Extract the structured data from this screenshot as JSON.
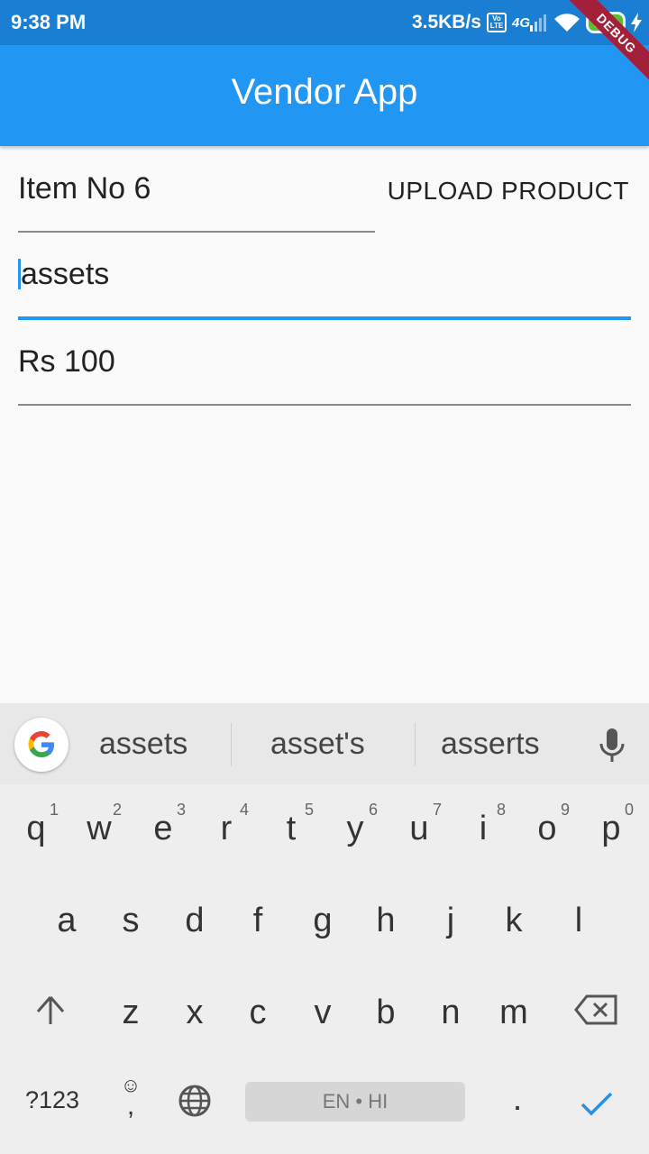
{
  "status_bar": {
    "time": "9:38 PM",
    "speed": "3.5KB/s",
    "network": "4G",
    "battery": "100"
  },
  "debug_banner": "DEBUG",
  "app_bar": {
    "title": "Vendor App"
  },
  "form": {
    "item_name": "Item No 6",
    "upload_button": "UPLOAD PRODUCT",
    "image_path": "assets",
    "price": "Rs 100"
  },
  "keyboard": {
    "suggestions": [
      "assets",
      "asset's",
      "asserts"
    ],
    "row1": [
      "q",
      "w",
      "e",
      "r",
      "t",
      "y",
      "u",
      "i",
      "o",
      "p"
    ],
    "row1_nums": [
      "1",
      "2",
      "3",
      "4",
      "5",
      "6",
      "7",
      "8",
      "9",
      "0"
    ],
    "row2": [
      "a",
      "s",
      "d",
      "f",
      "g",
      "h",
      "j",
      "k",
      "l"
    ],
    "row3": [
      "z",
      "x",
      "c",
      "v",
      "b",
      "n",
      "m"
    ],
    "symbols_key": "?123",
    "emoji_comma": ",",
    "space_label": "EN • HI",
    "period": "."
  }
}
